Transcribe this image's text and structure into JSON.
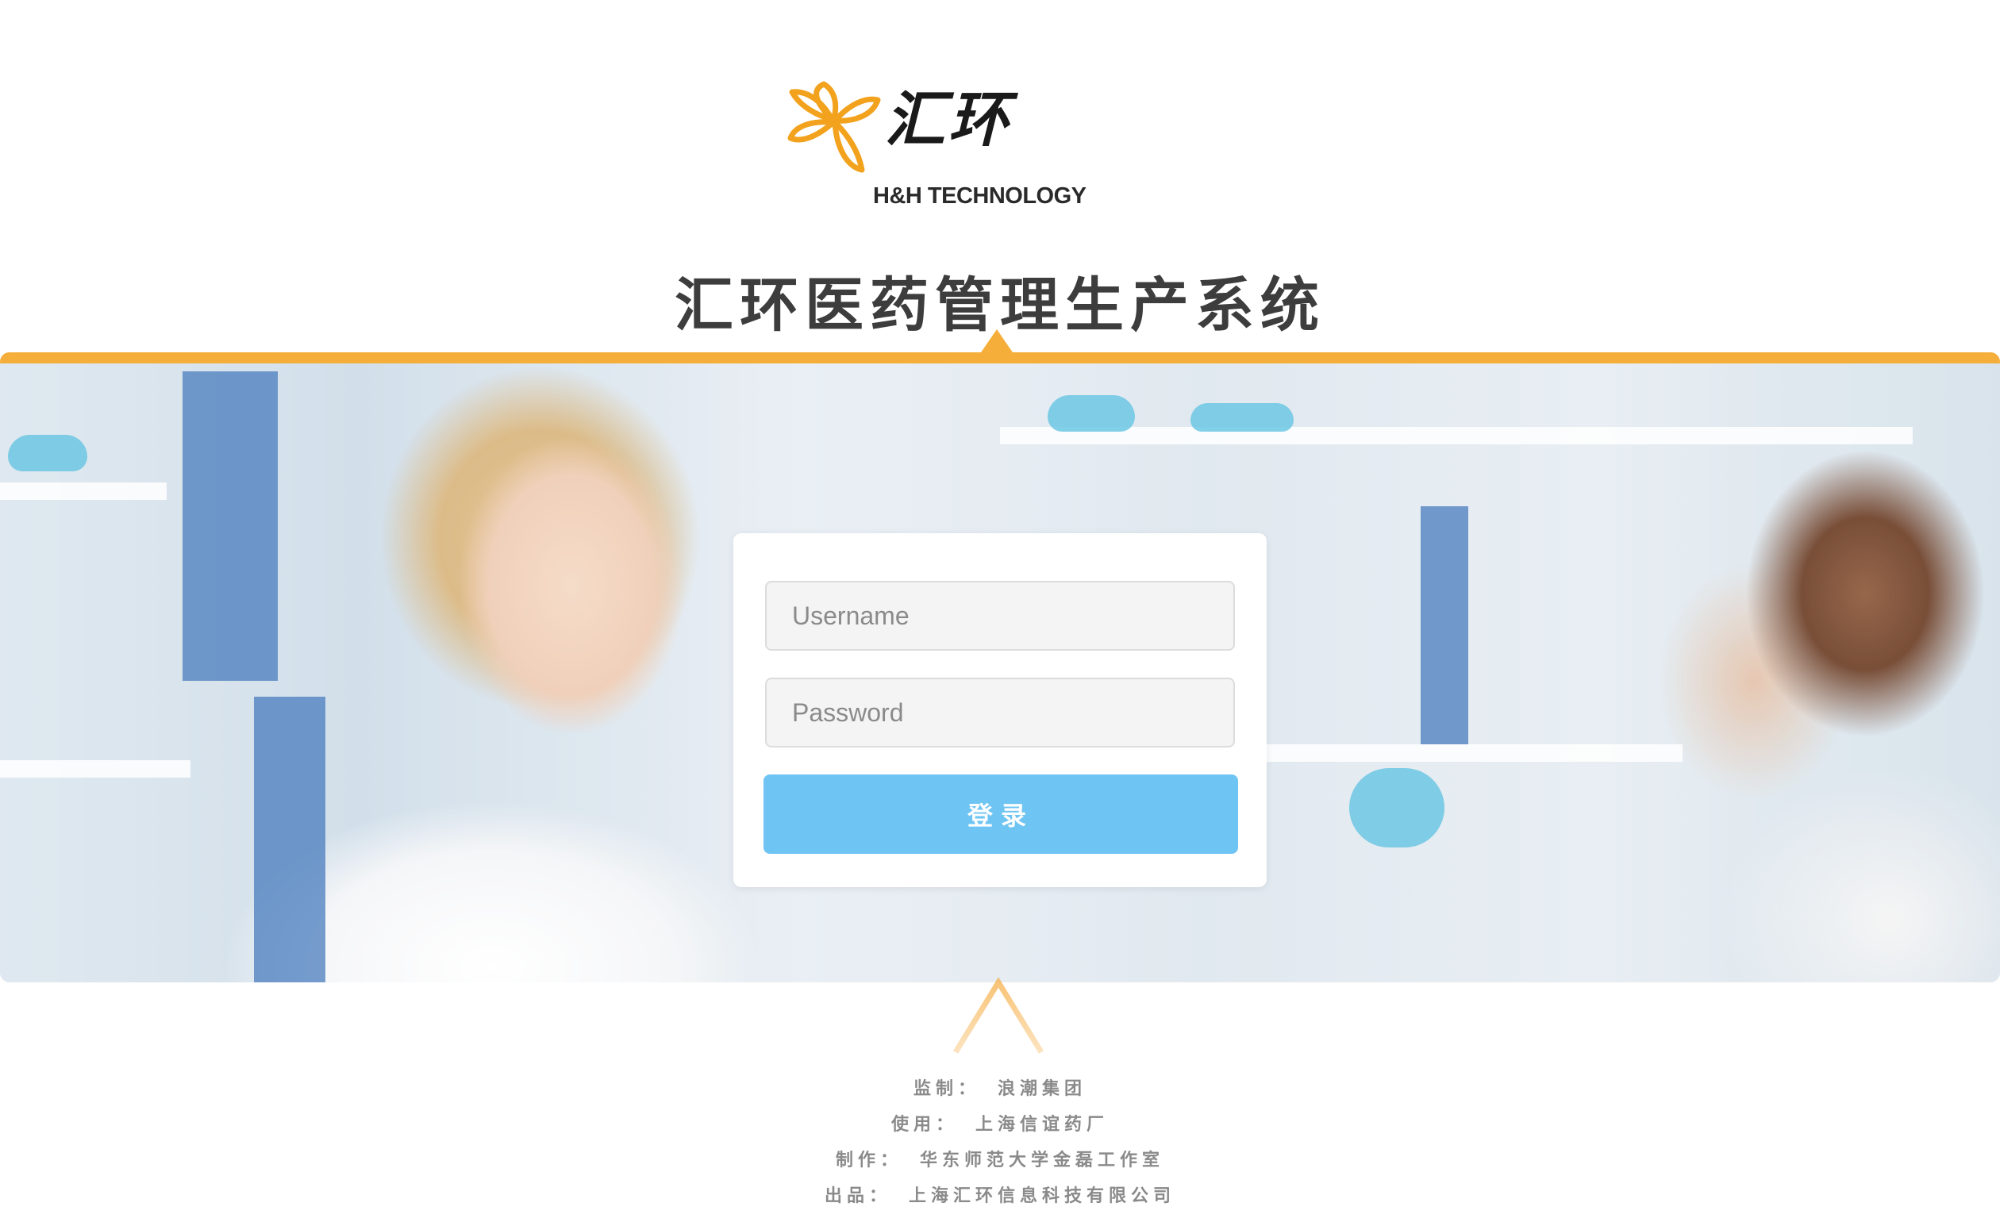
{
  "header": {
    "logo_cn": "汇环",
    "logo_en": "H&H TECHNOLOGY",
    "system_title": "汇环医药管理生产系统"
  },
  "login": {
    "username_placeholder": "Username",
    "password_placeholder": "Password",
    "submit_label": "登录"
  },
  "credits": [
    {
      "label": "监制：",
      "value": "浪潮集团"
    },
    {
      "label": "使用：",
      "value": "上海信谊药厂"
    },
    {
      "label": "制作：",
      "value": "华东师范大学金磊工作室"
    },
    {
      "label": "出品：",
      "value": "上海汇环信息科技有限公司"
    }
  ],
  "colors": {
    "accent_orange": "#f6ae3a",
    "button_blue": "#6ec4f2",
    "card_background": "#ffffff",
    "credit_text": "#8a8a8a",
    "title_text": "#3d3d3d"
  },
  "icons": {
    "logo_mark": "flower-icon",
    "footer_mark": "chevron-up-icon"
  }
}
